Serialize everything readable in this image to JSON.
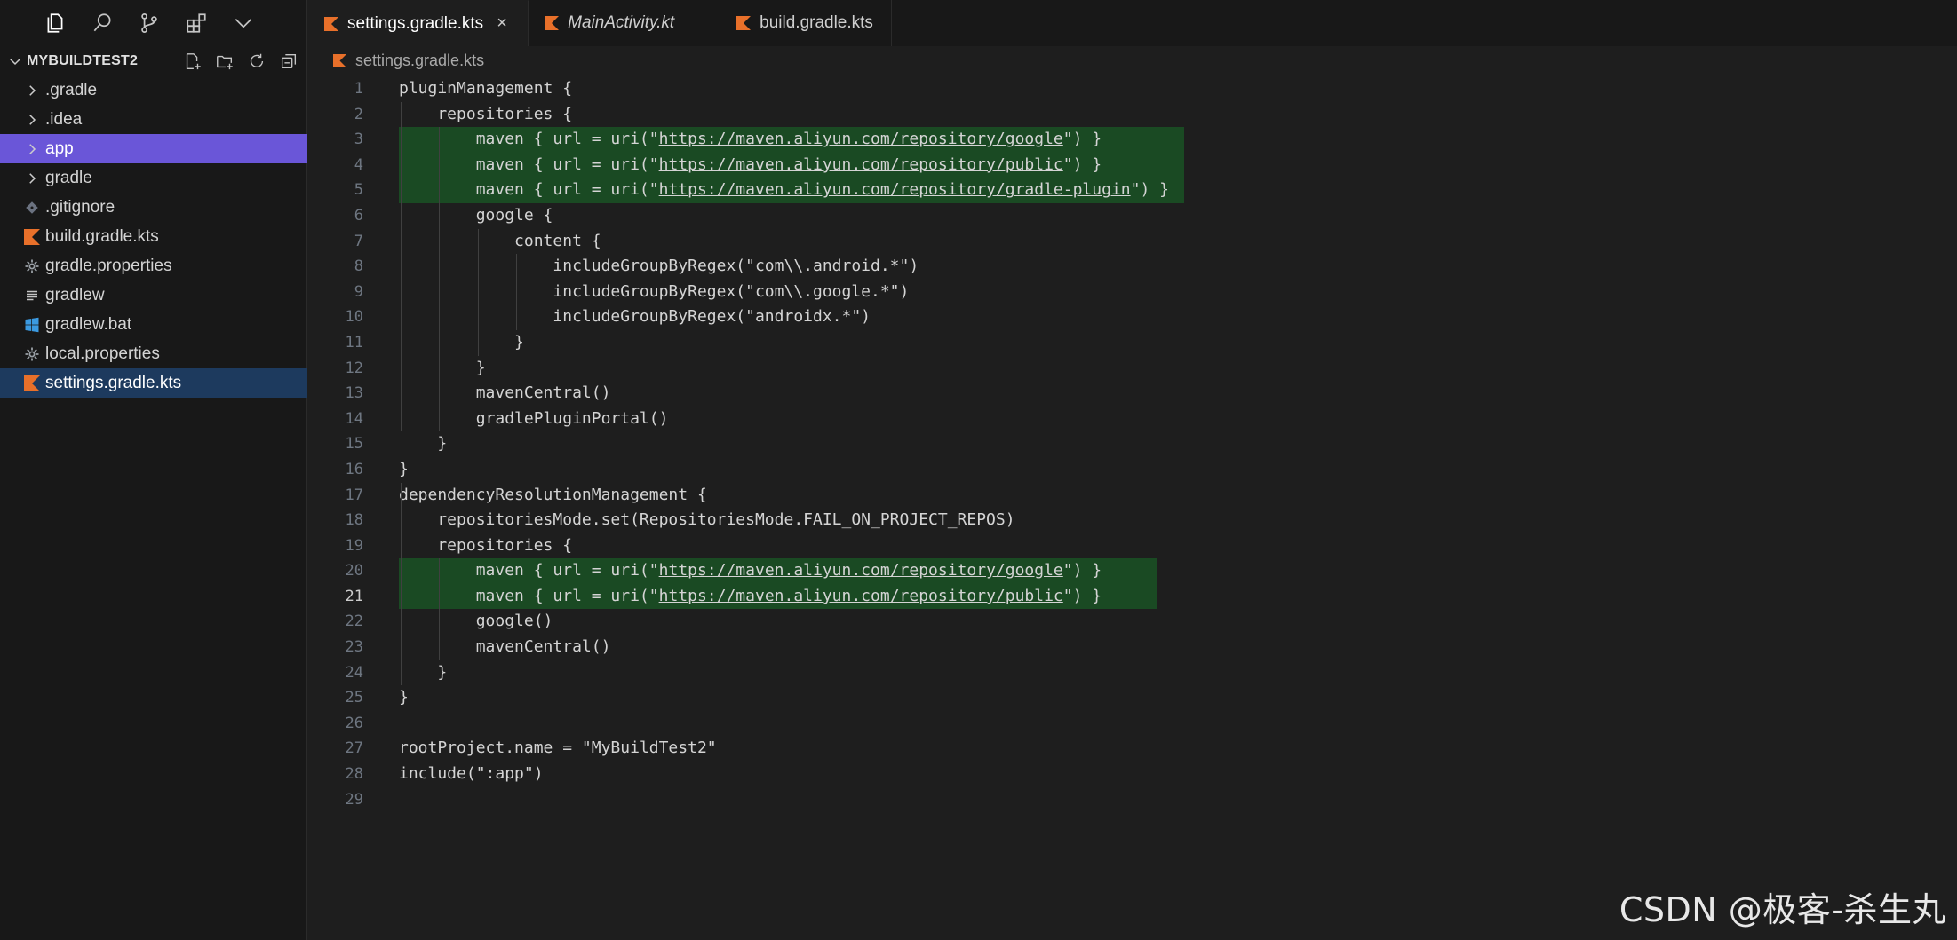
{
  "explorer": {
    "project_name": "MYBUILDTEST2",
    "items": [
      {
        "label": ".gradle",
        "kind": "folder"
      },
      {
        "label": ".idea",
        "kind": "folder"
      },
      {
        "label": "app",
        "kind": "folder",
        "selected": true
      },
      {
        "label": "gradle",
        "kind": "folder"
      },
      {
        "label": ".gitignore",
        "kind": "git"
      },
      {
        "label": "build.gradle.kts",
        "kind": "kotlin"
      },
      {
        "label": "gradle.properties",
        "kind": "gear"
      },
      {
        "label": "gradlew",
        "kind": "lines"
      },
      {
        "label": "gradlew.bat",
        "kind": "windows"
      },
      {
        "label": "local.properties",
        "kind": "gear"
      },
      {
        "label": "settings.gradle.kts",
        "kind": "kotlin",
        "active": true
      }
    ]
  },
  "tabs": [
    {
      "label": "settings.gradle.kts",
      "active": true,
      "close": "×"
    },
    {
      "label": "MainActivity.kt",
      "active": false
    },
    {
      "label": "build.gradle.kts",
      "active": false
    }
  ],
  "breadcrumb": "settings.gradle.kts",
  "code": {
    "lines": [
      "pluginManagement {",
      "    repositories {",
      "        maven { url = uri(\"https://maven.aliyun.com/repository/google\") }",
      "        maven { url = uri(\"https://maven.aliyun.com/repository/public\") }",
      "        maven { url = uri(\"https://maven.aliyun.com/repository/gradle-plugin\") }",
      "        google {",
      "            content {",
      "                includeGroupByRegex(\"com\\\\.android.*\")",
      "                includeGroupByRegex(\"com\\\\.google.*\")",
      "                includeGroupByRegex(\"androidx.*\")",
      "            }",
      "        }",
      "        mavenCentral()",
      "        gradlePluginPortal()",
      "    }",
      "}",
      "dependencyResolutionManagement {",
      "    repositoriesMode.set(RepositoriesMode.FAIL_ON_PROJECT_REPOS)",
      "    repositories {",
      "        maven { url = uri(\"https://maven.aliyun.com/repository/google\") }",
      "        maven { url = uri(\"https://maven.aliyun.com/repository/public\") }",
      "        google()",
      "        mavenCentral()",
      "    }",
      "}",
      "",
      "rootProject.name = \"MyBuildTest2\"",
      "include(\":app\")",
      ""
    ],
    "highlighted_lines": [
      3,
      4,
      5,
      20,
      21
    ],
    "current_line": 21
  },
  "watermark": "CSDN @极客-杀生丸",
  "colors": {
    "selection": "#6a56d8",
    "active_file": "#1d3a5e",
    "added_line": "#1a4a23",
    "kotlin_icon": "#e8702a"
  }
}
